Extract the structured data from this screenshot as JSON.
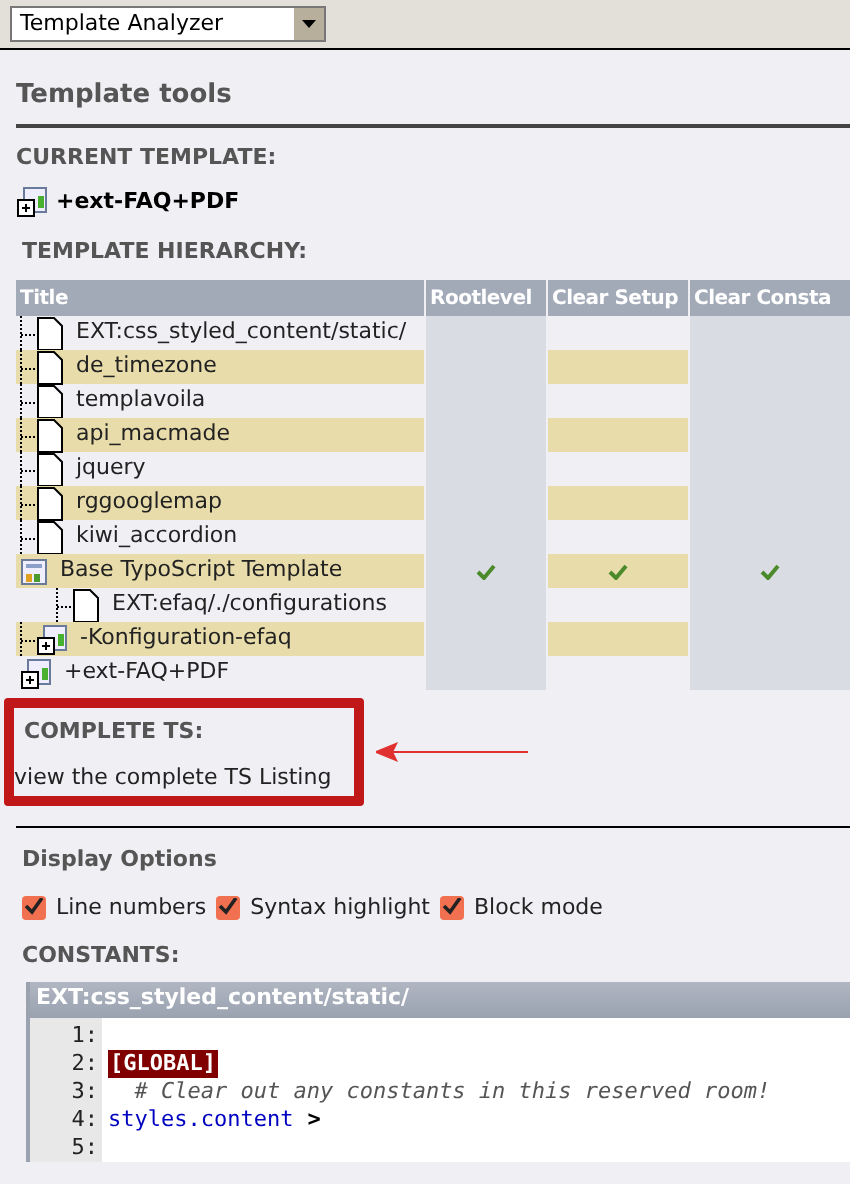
{
  "module_menu": {
    "value": "Template Analyzer"
  },
  "heading": "Template tools",
  "current_template": {
    "label": "CURRENT TEMPLATE:",
    "name": "+ext-FAQ+PDF"
  },
  "hierarchy": {
    "label": "TEMPLATE HIERARCHY:",
    "columns": [
      "Title",
      "Rootlevel",
      "Clear Setup",
      "Clear Consta"
    ],
    "rows": [
      {
        "title": "Base TypoScript Template",
        "kind": "template",
        "rootlevel": true,
        "clear_setup": true,
        "clear_constants": true,
        "children": [
          {
            "title": "EXT:css_styled_content/static/",
            "kind": "file",
            "rootlevel": false,
            "clear_setup": false,
            "clear_constants": false
          },
          {
            "title": "de_timezone",
            "kind": "file",
            "rootlevel": false,
            "clear_setup": false,
            "clear_constants": false
          },
          {
            "title": "templavoila",
            "kind": "file",
            "rootlevel": false,
            "clear_setup": false,
            "clear_constants": false
          },
          {
            "title": "api_macmade",
            "kind": "file",
            "rootlevel": false,
            "clear_setup": false,
            "clear_constants": false
          },
          {
            "title": "jquery",
            "kind": "file",
            "rootlevel": false,
            "clear_setup": false,
            "clear_constants": false
          },
          {
            "title": "rggooglemap",
            "kind": "file",
            "rootlevel": false,
            "clear_setup": false,
            "clear_constants": false
          },
          {
            "title": "kiwi_accordion",
            "kind": "file",
            "rootlevel": false,
            "clear_setup": false,
            "clear_constants": false
          }
        ]
      },
      {
        "title": "+ext-FAQ+PDF",
        "kind": "extension_template",
        "rootlevel": false,
        "clear_setup": false,
        "clear_constants": false,
        "children": [
          {
            "title": "-Konfiguration-efaq",
            "kind": "extension_template",
            "rootlevel": false,
            "clear_setup": false,
            "clear_constants": false,
            "children": [
              {
                "title": "EXT:efaq/./configurations",
                "kind": "file",
                "rootlevel": false,
                "clear_setup": false,
                "clear_constants": false
              }
            ]
          }
        ]
      }
    ]
  },
  "complete_ts": {
    "label": "COMPLETE TS:",
    "link": "view the complete TS Listing"
  },
  "display_options": {
    "label": "Display Options",
    "options": [
      {
        "label": "Line numbers",
        "checked": true
      },
      {
        "label": "Syntax highlight",
        "checked": true
      },
      {
        "label": "Block mode",
        "checked": true
      }
    ]
  },
  "constants": {
    "label": "CONSTANTS:",
    "block_title": "EXT:css_styled_content/static/",
    "lines": [
      {
        "number": "1:",
        "kind": "plain"
      },
      {
        "number": "2:",
        "text": "[GLOBAL]",
        "kind": "condition"
      },
      {
        "number": "3:",
        "text": "  # Clear out any constants in this reserved room!",
        "kind": "comment"
      },
      {
        "number": "4:",
        "text": "styles.content",
        "operator": ">",
        "kind": "assignment"
      },
      {
        "number": "5:",
        "kind": "plain"
      }
    ]
  }
}
